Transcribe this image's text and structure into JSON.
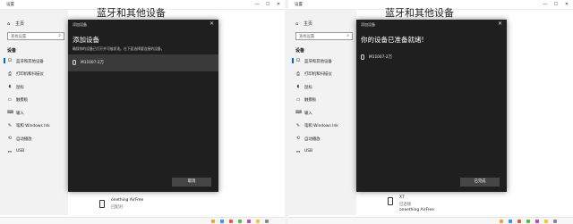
{
  "window": {
    "title": "设置",
    "minimize_glyph": "—",
    "maximize_glyph": "☐",
    "close_glyph": "✕"
  },
  "sidebar": {
    "home_label": "主页",
    "home_icon": "home-icon",
    "search_placeholder": "查找设置",
    "section_title": "设备",
    "items": [
      {
        "label": "蓝牙和其他设备",
        "icon": "bluetooth-icon",
        "glyph": "⊡",
        "active": true
      },
      {
        "label": "打印机和扫描仪",
        "icon": "printer-icon",
        "glyph": "⎙"
      },
      {
        "label": "鼠标",
        "icon": "mouse-icon",
        "glyph": "◖"
      },
      {
        "label": "触摸板",
        "icon": "touchpad-icon",
        "glyph": "▭"
      },
      {
        "label": "输入",
        "icon": "keyboard-icon",
        "glyph": "⌨"
      },
      {
        "label": "笔和 Windows Ink",
        "icon": "pen-icon",
        "glyph": "✎"
      },
      {
        "label": "自动播放",
        "icon": "autoplay-icon",
        "glyph": "⟲"
      },
      {
        "label": "USB",
        "icon": "usb-icon",
        "glyph": "⏛"
      }
    ]
  },
  "main": {
    "heading": "蓝牙和其他设备"
  },
  "left": {
    "dialog": {
      "title": "添加设备",
      "close_glyph": "✕",
      "heading": "添加设备",
      "subtitle": "确保你的设备已打开并可被发现。在下面选择要连接的设备。",
      "device_name": "M11007-2万",
      "button_label": "取消"
    },
    "bottom_device": {
      "name": "onething AirFree",
      "status": "已配对"
    }
  },
  "right": {
    "dialog": {
      "title": "添加设备",
      "close_glyph": "✕",
      "heading": "你的设备已准备就绪!",
      "device_name": "M11007-2万",
      "button_label": "已完成"
    },
    "bottom_device": {
      "name": "X7",
      "status": "已连接",
      "name2": "oneething AirFree"
    }
  },
  "colors": {
    "accent": "#0067c0",
    "dialog_bg": "#1f1f1f",
    "sidebar_bg": "#f2f2f2"
  }
}
